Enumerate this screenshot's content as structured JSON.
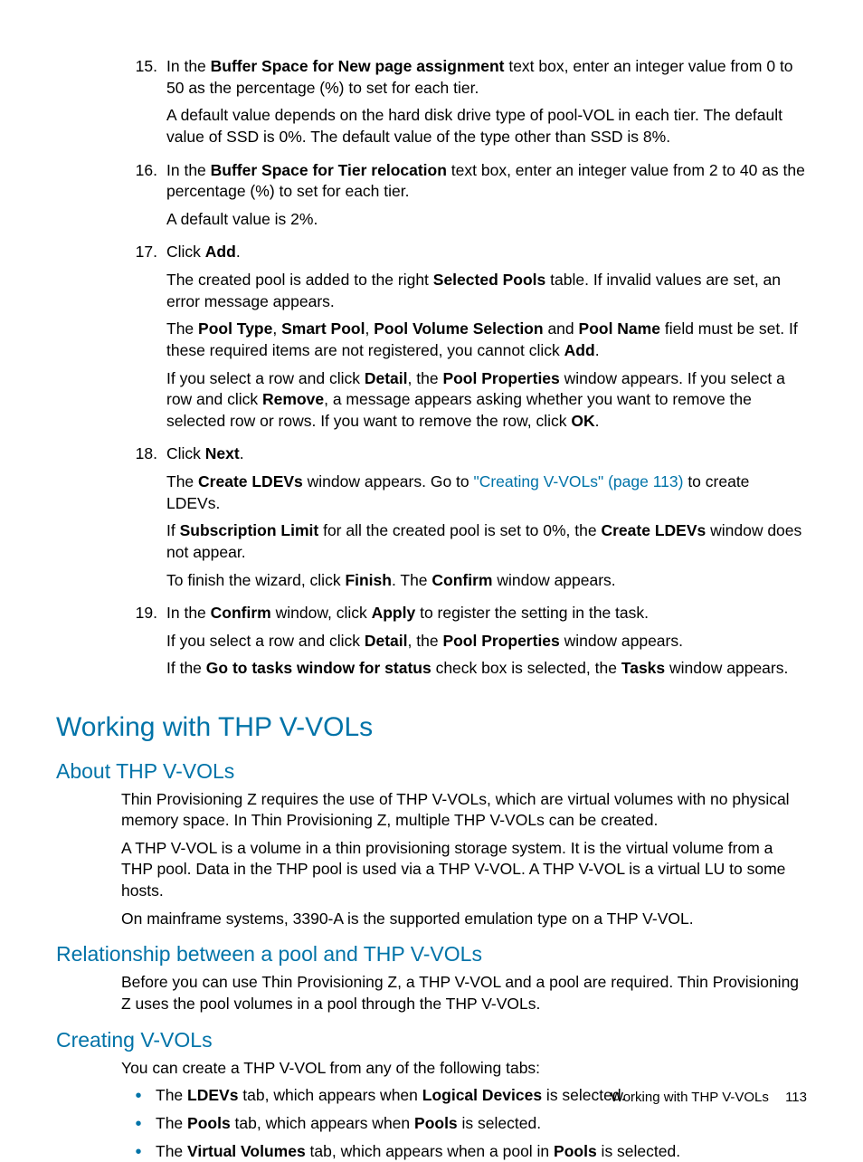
{
  "steps": {
    "s15": {
      "num": "15.",
      "p1a": "In the ",
      "p1b": "Buffer Space for New page assignment",
      "p1c": " text box, enter an integer value from 0 to 50 as the percentage (%) to set for each tier.",
      "p2": "A default value depends on the hard disk drive type of pool-VOL in each tier. The default value of SSD is 0%. The default value of the type other than SSD is 8%."
    },
    "s16": {
      "num": "16.",
      "p1a": "In the ",
      "p1b": "Buffer Space for Tier relocation",
      "p1c": " text box, enter an integer value from 2 to 40 as the percentage (%) to set for each tier.",
      "p2": "A default value is 2%."
    },
    "s17": {
      "num": "17.",
      "p1a": "Click ",
      "p1b": "Add",
      "p1c": ".",
      "p2a": "The created pool is added to the right ",
      "p2b": "Selected Pools",
      "p2c": " table. If invalid values are set, an error message appears.",
      "p3a": "The ",
      "p3b": "Pool Type",
      "p3c": ", ",
      "p3d": "Smart Pool",
      "p3e": ", ",
      "p3f": "Pool Volume Selection",
      "p3g": " and ",
      "p3h": "Pool Name",
      "p3i": " field must be set. If these required items are not registered, you cannot click ",
      "p3j": "Add",
      "p3k": ".",
      "p4a": "If you select a row and click ",
      "p4b": "Detail",
      "p4c": ", the ",
      "p4d": "Pool Properties",
      "p4e": " window appears. If you select a row and click ",
      "p4f": "Remove",
      "p4g": ", a message appears asking whether you want to remove the selected row or rows. If you want to remove the row, click ",
      "p4h": "OK",
      "p4i": "."
    },
    "s18": {
      "num": "18.",
      "p1a": "Click ",
      "p1b": "Next",
      "p1c": ".",
      "p2a": "The ",
      "p2b": "Create LDEVs",
      "p2c": " window appears. Go to ",
      "p2link": "\"Creating V-VOLs\" (page 113)",
      "p2d": " to create LDEVs.",
      "p3a": "If ",
      "p3b": "Subscription Limit",
      "p3c": " for all the created pool is set to 0%, the ",
      "p3d": "Create LDEVs",
      "p3e": " window does not appear.",
      "p4a": "To finish the wizard, click ",
      "p4b": "Finish",
      "p4c": ". The ",
      "p4d": "Confirm",
      "p4e": " window appears."
    },
    "s19": {
      "num": "19.",
      "p1a": "In the ",
      "p1b": "Confirm",
      "p1c": " window, click ",
      "p1d": "Apply",
      "p1e": " to register the setting in the task.",
      "p2a": "If you select a row and click ",
      "p2b": "Detail",
      "p2c": ", the ",
      "p2d": "Pool Properties",
      "p2e": " window appears.",
      "p3a": "If the ",
      "p3b": "Go to tasks window for status",
      "p3c": " check box is selected, the ",
      "p3d": "Tasks",
      "p3e": " window appears."
    }
  },
  "h1": "Working with THP V-VOLs",
  "about": {
    "h": "About THP V-VOLs",
    "p1": "Thin Provisioning Z requires the use of THP V-VOLs, which are virtual volumes with no physical memory space. In Thin Provisioning Z, multiple THP V-VOLs can be created.",
    "p2": "A THP V-VOL is a volume in a thin provisioning storage system. It is the virtual volume from a THP pool. Data in the THP pool is used via a THP V-VOL. A THP V-VOL is a virtual LU to some hosts.",
    "p3": "On mainframe systems, 3390-A is the supported emulation type on a THP V-VOL."
  },
  "rel": {
    "h": "Relationship between a pool and THP V-VOLs",
    "p1": "Before you can use Thin Provisioning Z, a THP V-VOL and a pool are required. Thin Provisioning Z uses the pool volumes in a pool through the THP V-VOLs."
  },
  "create": {
    "h": "Creating V-VOLs",
    "p1": "You can create a THP V-VOL from any of the following tabs:",
    "b1a": "The ",
    "b1b": "LDEVs",
    "b1c": " tab, which appears when ",
    "b1d": "Logical Devices",
    "b1e": " is selected.",
    "b2a": "The ",
    "b2b": "Pools",
    "b2c": " tab, which appears when ",
    "b2d": "Pools",
    "b2e": " is selected.",
    "b3a": "The ",
    "b3b": "Virtual Volumes",
    "b3c": " tab, which appears when a pool in ",
    "b3d": "Pools",
    "b3e": " is selected."
  },
  "footer": {
    "text": "Working with THP V-VOLs",
    "page": "113"
  }
}
